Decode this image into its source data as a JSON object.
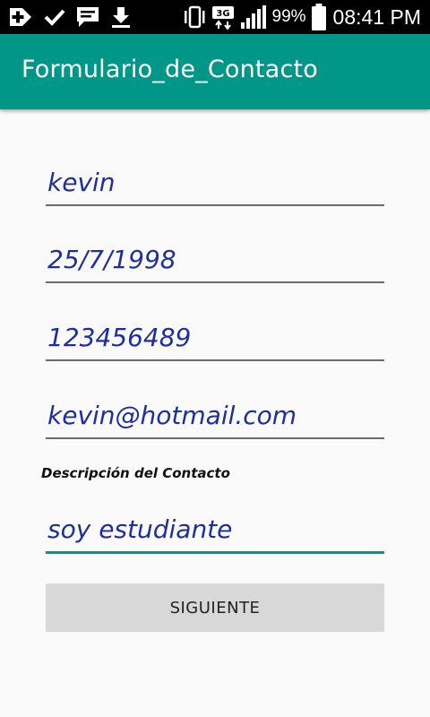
{
  "status_bar": {
    "network_type": "3G",
    "battery_percent": "99%",
    "time": "08:41 PM",
    "icons_left": [
      "add-box-icon",
      "check-icon",
      "message-icon",
      "download-icon"
    ],
    "icons_right": [
      "vibrate-icon",
      "network-3g-icon",
      "signal-icon",
      "battery-icon"
    ]
  },
  "app_bar": {
    "title": "Formulario_de_Contacto",
    "color": "#009688"
  },
  "form": {
    "name": "kevin",
    "birth_date": "25/7/1998",
    "phone": "123456489",
    "email": "kevin@hotmail.com",
    "description_label": "Descripción del Contacto",
    "description": "soy estudiante",
    "input_text_color": "#1f2d9e",
    "focus_color": "#009688"
  },
  "actions": {
    "next_label": "SIGUIENTE"
  }
}
